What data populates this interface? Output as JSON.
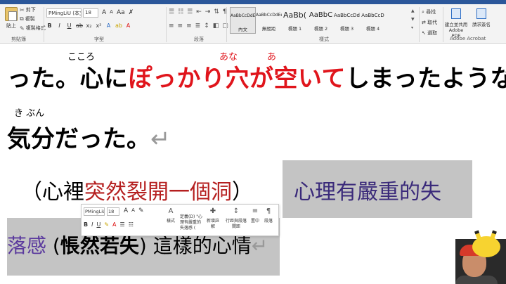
{
  "ribbon": {
    "clipboard": {
      "paste": "貼上",
      "cut": "剪下",
      "copy": "複製",
      "format_painter": "複製格式",
      "group": "剪貼簿"
    },
    "font": {
      "name": "PMingLiU (本文)",
      "size": "18",
      "group": "字型"
    },
    "paragraph": {
      "group": "段落"
    },
    "styles": {
      "group": "樣式",
      "items": [
        {
          "preview": "AaBbCcDdEe",
          "name": "內文"
        },
        {
          "preview": "AaBbCcDdEe",
          "name": "無間距"
        },
        {
          "preview": "AaBb(",
          "name": "標題 1"
        },
        {
          "preview": "AaBbC",
          "name": "標題 2"
        },
        {
          "preview": "AaBbCcDd",
          "name": "標題 3"
        },
        {
          "preview": "AaBbCcD",
          "name": "標題 4"
        }
      ]
    },
    "editing": {
      "find": "尋找",
      "replace": "取代",
      "select": "選取"
    },
    "acrobat": {
      "create_pdf": "建立並共用 Adobe PDF",
      "request_sign": "請求簽名",
      "group": "Adobe Acrobat"
    }
  },
  "document": {
    "ruby1": {
      "kokoro": "こころ",
      "ana": "あな",
      "a": "あ"
    },
    "line1": {
      "part1": "った。心に",
      "part2": "ぽっかり穴が空いて",
      "part3": "しまったような"
    },
    "ruby2": {
      "kibun": "き ぶん"
    },
    "line2": "気分だった。",
    "line3": {
      "open": "（心裡",
      "translation": "突然裂開一個洞",
      "close": "）"
    },
    "highlight1": "心理有嚴重的失",
    "line4": {
      "part1": "落感",
      "paren_open": "(",
      "part2": "悵然若失",
      "paren_close": ")",
      "part3": "這樣的心情"
    },
    "para_mark": "↵"
  },
  "mini_toolbar": {
    "font": "PMingLiU",
    "size": "18",
    "styles": "樣式",
    "define": "定義(D) \"心理有嚴重的失落感 (",
    "new_comment": "新增註解",
    "line_spacing": "行距與段落間距",
    "center": "置中",
    "paragraph": "段落"
  }
}
